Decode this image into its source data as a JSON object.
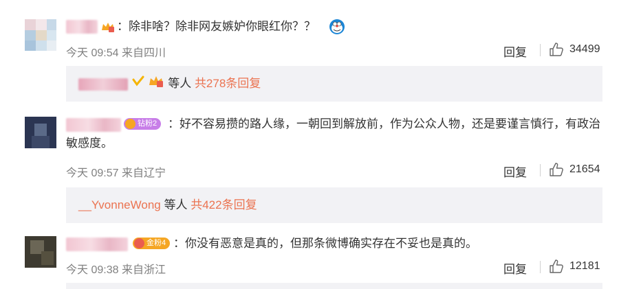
{
  "comments": [
    {
      "text": "：除非啥？除非网友嫉妒你眼红你？？",
      "time": "今天 09:54",
      "location": "来自四川",
      "reply_label": "回复",
      "likes": "34499",
      "subreplies": {
        "suffix": "等人",
        "total": "共278条回复"
      }
    },
    {
      "badge": "钻粉2",
      "badge_color": "#c87ee8",
      "text": "：好不容易攒的路人缘，一朝回到解放前，作为公众人物，还是要谨言慎行，有政治敏感度。",
      "time": "今天 09:57",
      "location": "来自辽宁",
      "reply_label": "回复",
      "likes": "21654",
      "subreplies": {
        "name": "__YvonneWong",
        "suffix": "等人",
        "total": "共422条回复"
      }
    },
    {
      "badge": "金粉4",
      "badge_color": "#f5a623",
      "text": "：你没有恶意是真的，但那条微博确实存在不妥也是真的。",
      "time": "今天 09:38",
      "location": "来自浙江",
      "reply_label": "回复",
      "likes": "12181"
    }
  ],
  "colors": {
    "link": "#eb7350",
    "meta": "#808080",
    "sub_bg": "#f2f2f5"
  },
  "icons": [
    "like-icon",
    "crown-icon",
    "vip-icon",
    "doraemon-emoji"
  ]
}
